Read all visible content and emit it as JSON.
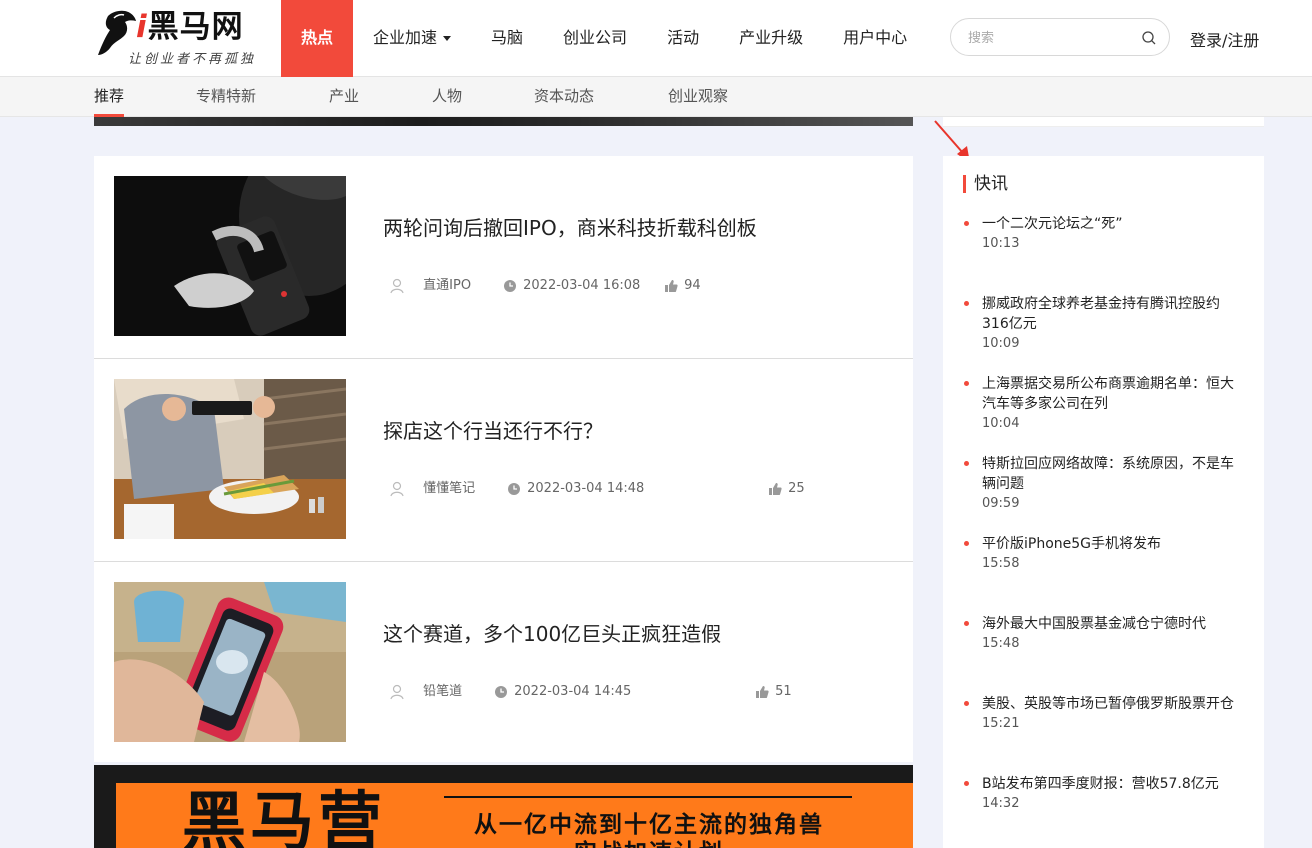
{
  "header": {
    "logo": {
      "prefix": "i",
      "name": "黑马网",
      "slogan": "让创业者不再孤独"
    },
    "nav": [
      {
        "label": "热点",
        "active": true
      },
      {
        "label": "企业加速",
        "dropdown": true
      },
      {
        "label": "马脑"
      },
      {
        "label": "创业公司"
      },
      {
        "label": "活动"
      },
      {
        "label": "产业升级"
      },
      {
        "label": "用户中心"
      }
    ],
    "search": {
      "placeholder": "搜索",
      "value": ""
    },
    "login_label": "登录/注册"
  },
  "subnav": [
    {
      "label": "推荐",
      "active": true
    },
    {
      "label": "专精特新"
    },
    {
      "label": "产业"
    },
    {
      "label": "人物"
    },
    {
      "label": "资本动态"
    },
    {
      "label": "创业观察"
    }
  ],
  "articles": [
    {
      "title": "两轮问询后撤回IPO，商米科技折载科创板",
      "author": "直通IPO",
      "time": "2022-03-04 16:08",
      "likes": "94"
    },
    {
      "title": "探店这个行当还行不行？",
      "author": "懂懂笔记",
      "time": "2022-03-04 14:48",
      "likes": "25"
    },
    {
      "title": "这个赛道，多个100亿巨头正疯狂造假",
      "author": "铅笔道",
      "time": "2022-03-04 14:45",
      "likes": "51"
    }
  ],
  "ad": {
    "logo_text": "黑马营",
    "slogan": "从一亿中流到十亿主流的独角兽",
    "slogan2": "实战加速计划"
  },
  "news": {
    "title": "快讯",
    "items": [
      {
        "title": "一个二次元论坛之“死”",
        "time": "10:13"
      },
      {
        "title": "挪威政府全球养老基金持有腾讯控股约316亿元",
        "time": "10:09"
      },
      {
        "title": "上海票据交易所公布商票逾期名单：恒大汽车等多家公司在列",
        "time": "10:04"
      },
      {
        "title": "特斯拉回应网络故障：系统原因，不是车辆问题",
        "time": "09:59"
      },
      {
        "title": "平价版iPhone5G手机将发布",
        "time": "15:58"
      },
      {
        "title": "海外最大中国股票基金减仓宁德时代",
        "time": "15:48"
      },
      {
        "title": "美股、英股等市场已暂停俄罗斯股票开仓",
        "time": "15:21"
      },
      {
        "title": "B站发布第四季度财报：营收57.8亿元",
        "time": "14:32"
      }
    ]
  },
  "colors": {
    "accent": "#f24a3b",
    "background": "#f0f2fa",
    "ad_orange": "#ff7a1a"
  }
}
